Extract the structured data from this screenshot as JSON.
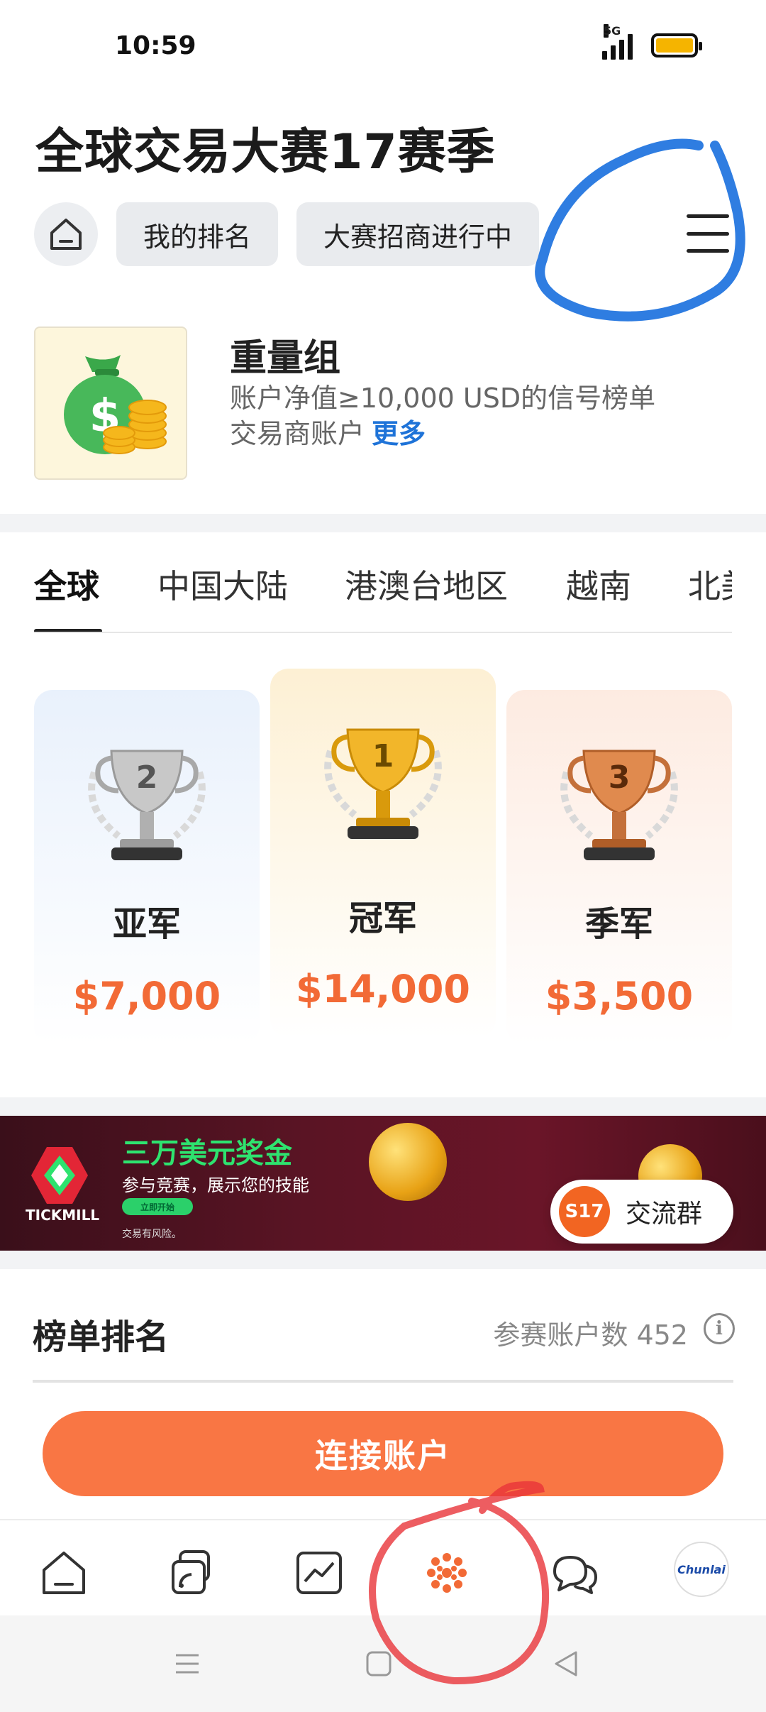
{
  "status_bar": {
    "time": "10:59",
    "network": "5G",
    "battery_color": "#f5b400"
  },
  "header": {
    "title": "全球交易大赛17赛季",
    "my_rank_label": "我的排名",
    "recruit_label": "大赛招商进行中"
  },
  "group": {
    "name": "重量组",
    "description": "账户净值≥10,000 USD的信号榜单交易商账户",
    "more_label": "更多"
  },
  "region_tabs": [
    {
      "label": "全球",
      "active": true
    },
    {
      "label": "中国大陆",
      "active": false
    },
    {
      "label": "港澳台地区",
      "active": false
    },
    {
      "label": "越南",
      "active": false
    },
    {
      "label": "北美",
      "active": false
    }
  ],
  "podium": {
    "second": {
      "rank": "2",
      "label": "亚军",
      "prize": "$7,000"
    },
    "first": {
      "rank": "1",
      "label": "冠军",
      "prize": "$14,000"
    },
    "third": {
      "rank": "3",
      "label": "季军",
      "prize": "$3,500"
    }
  },
  "banner": {
    "brand": "TICKMILL",
    "title": "三万美元奖金",
    "subtitle": "参与竞赛，展示您的技能",
    "cta": "立即开始",
    "risk_note": "交易有风险。",
    "group_badge": "S17",
    "group_label": "交流群"
  },
  "ranking": {
    "title": "榜单排名",
    "count_label": "参赛账户数 452"
  },
  "connect_button_label": "连接账户",
  "bottom_nav": {
    "avatar_text": "Chunlai",
    "accent_color": "#f26a36"
  },
  "colors": {
    "accent": "#f97644",
    "prize": "#f26a36",
    "link": "#1e73d8"
  }
}
